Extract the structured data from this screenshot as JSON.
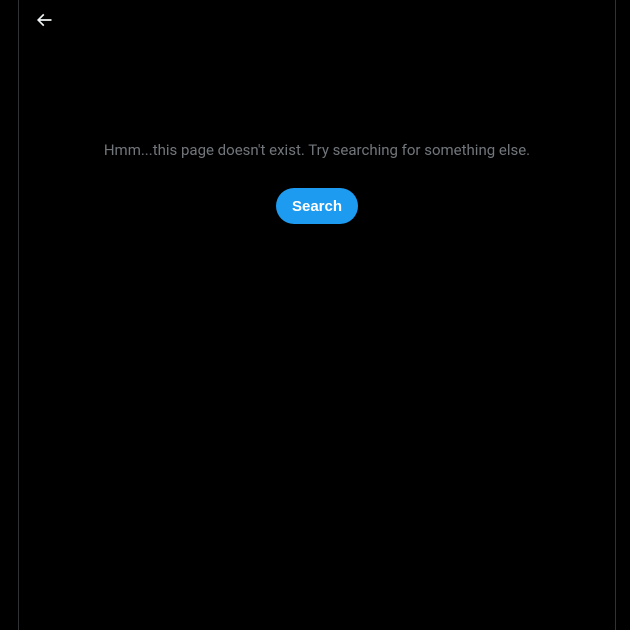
{
  "header": {
    "back_icon": "arrow-left"
  },
  "main": {
    "error_message": "Hmm...this page doesn't exist. Try searching for something else.",
    "search_button_label": "Search"
  },
  "colors": {
    "background": "#000000",
    "border": "#2f3336",
    "text_muted": "#71767b",
    "primary": "#1d9bf0",
    "text_light": "#eff3f4",
    "button_text": "#ffffff"
  }
}
